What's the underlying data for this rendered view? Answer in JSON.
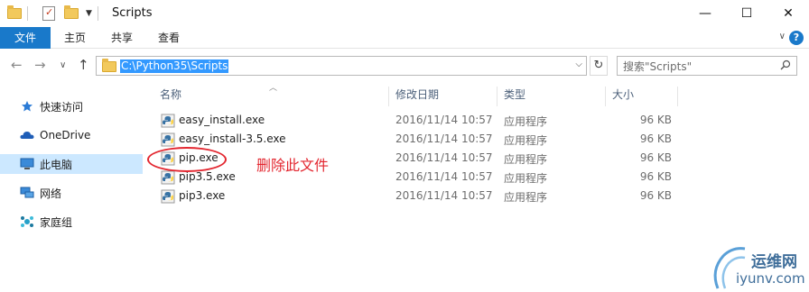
{
  "window": {
    "title": "Scripts",
    "controls": {
      "minimize": "—",
      "maximize": "☐",
      "close": "✕"
    }
  },
  "ribbon": {
    "tabs": [
      "文件",
      "主页",
      "共享",
      "查看"
    ],
    "expand_label": "∨",
    "help_label": "?"
  },
  "nav": {
    "back": "←",
    "forward": "→",
    "recent": "∨",
    "up": "↑",
    "address": "C:\\Python35\\Scripts",
    "refresh": "↻",
    "search_placeholder": "搜索\"Scripts\""
  },
  "sidebar": {
    "items": [
      {
        "label": "快速访问",
        "icon": "star-pin-icon"
      },
      {
        "label": "OneDrive",
        "icon": "cloud-icon"
      },
      {
        "label": "此电脑",
        "icon": "computer-icon"
      },
      {
        "label": "网络",
        "icon": "network-icon"
      },
      {
        "label": "家庭组",
        "icon": "homegroup-icon"
      }
    ],
    "active_index": 2
  },
  "columns": [
    "名称",
    "修改日期",
    "类型",
    "大小"
  ],
  "files": [
    {
      "name": "easy_install.exe",
      "date": "2016/11/14 10:57",
      "type": "应用程序",
      "size": "96 KB"
    },
    {
      "name": "easy_install-3.5.exe",
      "date": "2016/11/14 10:57",
      "type": "应用程序",
      "size": "96 KB"
    },
    {
      "name": "pip.exe",
      "date": "2016/11/14 10:57",
      "type": "应用程序",
      "size": "96 KB"
    },
    {
      "name": "pip3.5.exe",
      "date": "2016/11/14 10:57",
      "type": "应用程序",
      "size": "96 KB"
    },
    {
      "name": "pip3.exe",
      "date": "2016/11/14 10:57",
      "type": "应用程序",
      "size": "96 KB"
    }
  ],
  "annotation": "删除此文件",
  "watermark": {
    "cn": "运维网",
    "url": "iyunv.com"
  },
  "colors": {
    "accent": "#1979ca",
    "selection": "#cce8ff",
    "annotation": "#e3262f"
  }
}
